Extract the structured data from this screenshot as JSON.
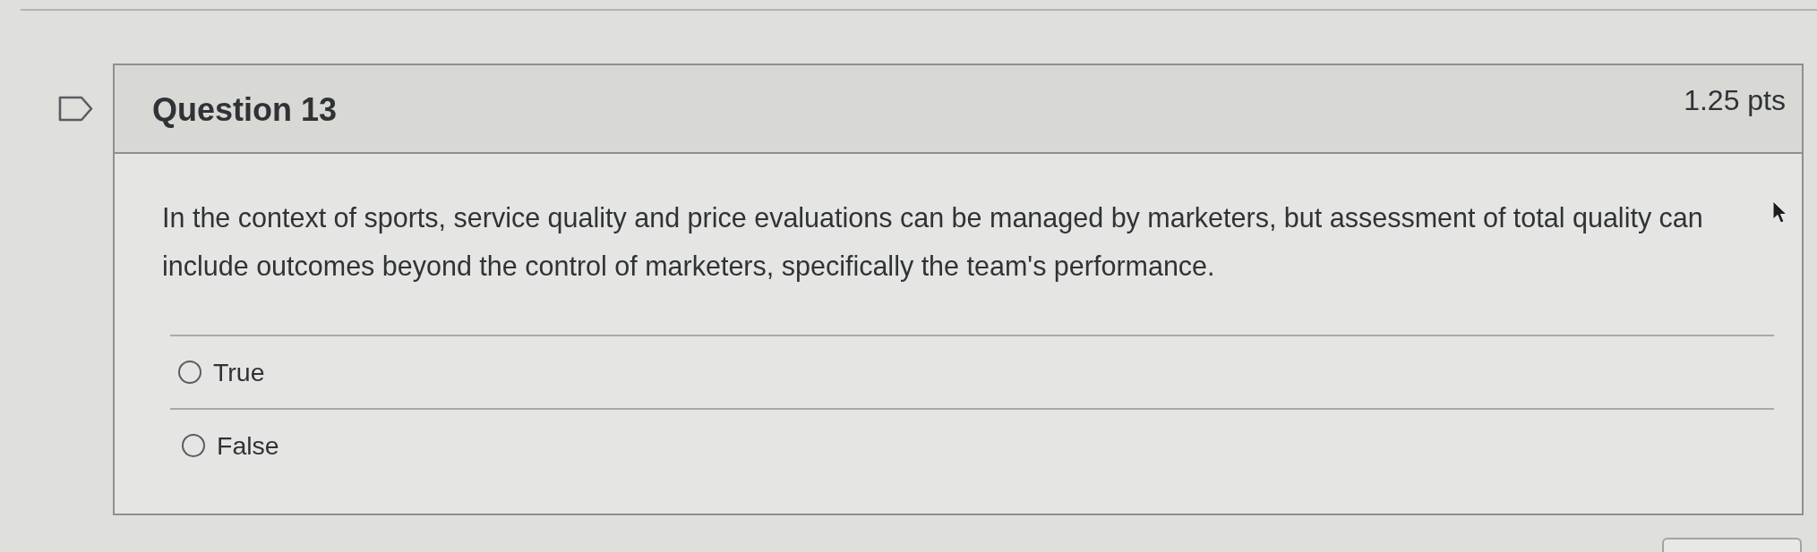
{
  "question": {
    "title": "Question 13",
    "points": "1.25 pts",
    "flagged": false,
    "text": "In the context of sports, service quality and price evaluations can be managed by marketers, but assessment of total quality can include outcomes beyond the control of marketers, specifically the team's performance.",
    "answers": [
      {
        "label": "True",
        "selected": false
      },
      {
        "label": "False",
        "selected": false
      }
    ]
  }
}
